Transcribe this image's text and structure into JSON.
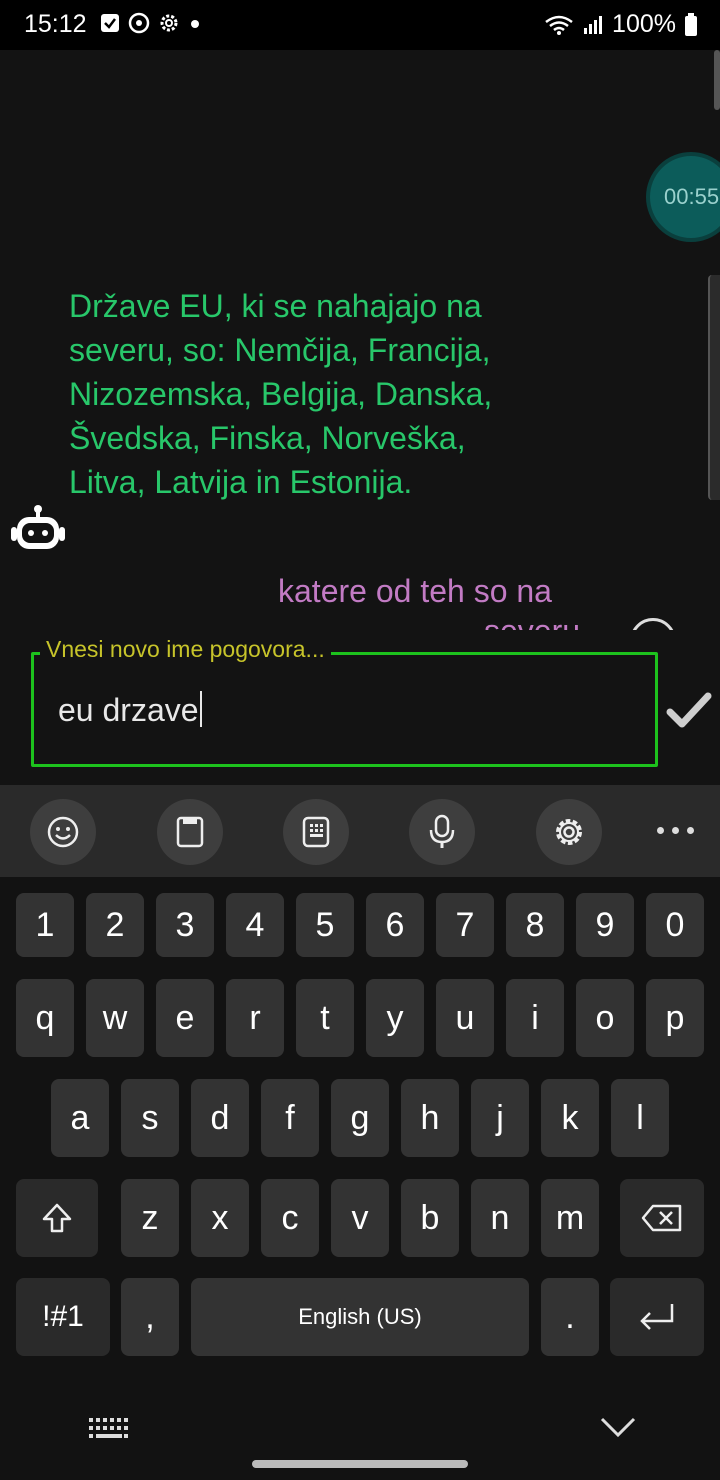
{
  "status_bar": {
    "time": "15:12",
    "battery": "100%"
  },
  "chat": {
    "timer": "00:55",
    "bot_message": "Države EU, ki se nahajajo na severu, so: Nemčija, Francija, Nizozemska, Belgija, Danska, Švedska, Finska, Norveška, Litva, Latvija in Estonija.",
    "user_message_line1": "katere od teh so na",
    "user_message_line2": "severu"
  },
  "rename_dialog": {
    "label": "Vnesi novo ime pogovora...",
    "value": "eu drzave"
  },
  "keyboard": {
    "toolbar": [
      "emoji-icon",
      "clipboard-icon",
      "keypad-icon",
      "microphone-icon",
      "settings-icon",
      "more-icon"
    ],
    "row_numbers": [
      "1",
      "2",
      "3",
      "4",
      "5",
      "6",
      "7",
      "8",
      "9",
      "0"
    ],
    "row1": [
      "q",
      "w",
      "e",
      "r",
      "t",
      "y",
      "u",
      "i",
      "o",
      "p"
    ],
    "row2": [
      "a",
      "s",
      "d",
      "f",
      "g",
      "h",
      "j",
      "k",
      "l"
    ],
    "row3": [
      "z",
      "x",
      "c",
      "v",
      "b",
      "n",
      "m"
    ],
    "symbols_label": "!#1",
    "comma": ",",
    "space_label": "English (US)",
    "period": "."
  },
  "colors": {
    "bot_text": "#28c76a",
    "user_text": "#c27bc4",
    "field_border": "#1dc21d",
    "field_label": "#c7c42a"
  }
}
